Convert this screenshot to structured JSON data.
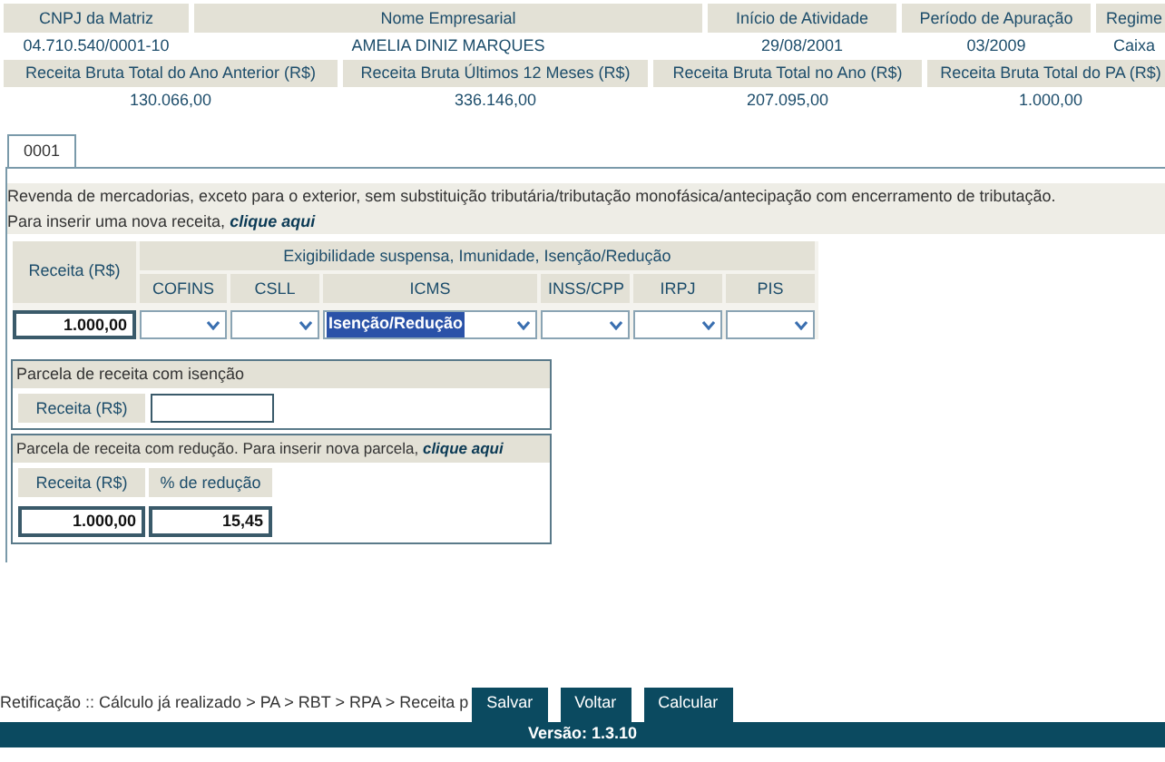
{
  "summary_row1": [
    {
      "label": "CNPJ da Matriz",
      "value": "04.710.540/0001-10"
    },
    {
      "label": "Nome Empresarial",
      "value": "AMELIA DINIZ MARQUES"
    },
    {
      "label": "Início de Atividade",
      "value": "29/08/2001"
    },
    {
      "label": "Período de Apuração",
      "value": "03/2009"
    },
    {
      "label": "Regime",
      "value": "Caixa"
    }
  ],
  "summary_row2": [
    {
      "label": "Receita Bruta Total do Ano Anterior (R$)",
      "value": "130.066,00"
    },
    {
      "label": "Receita Bruta Últimos 12 Meses (R$)",
      "value": "336.146,00"
    },
    {
      "label": "Receita Bruta Total no Ano (R$)",
      "value": "207.095,00"
    },
    {
      "label": "Receita Bruta Total do PA (R$)",
      "value": "1.000,00"
    }
  ],
  "tabs": [
    {
      "label": "0001",
      "selected": true
    }
  ],
  "description": "Revenda de mercadorias, exceto para o exterior, sem substituição tributária/tributação monofásica/antecipação com encerramento de tributação.",
  "insert_text": "Para inserir uma nova receita,",
  "insert_link": "clique aqui",
  "receita_table": {
    "receita_header": "Receita (R$)",
    "group_header": "Exigibilidade suspensa, Imunidade, Isenção/Redução",
    "receita_value": "1.000,00",
    "taxes": [
      {
        "name": "COFINS"
      },
      {
        "name": "CSLL"
      },
      {
        "name": "ICMS",
        "value": "Isenção/Redução"
      },
      {
        "name": "INSS/CPP"
      },
      {
        "name": "IRPJ"
      },
      {
        "name": "PIS"
      }
    ]
  },
  "isencao": {
    "title": "Parcela de receita com isenção",
    "label": "Receita (R$)"
  },
  "reducao": {
    "title": "Parcela de receita com redução. Para inserir nova parcela,",
    "link": "clique aqui",
    "col_receita": "Receita (R$)",
    "col_percent": "% de redução",
    "receita": "1.000,00",
    "percent": "15,45"
  },
  "breadcrumb": "Retificação :: Cálculo já realizado > PA > RBT > RPA > Receita p",
  "buttons": [
    "Salvar",
    "Voltar",
    "Calcular"
  ],
  "version": "Versão: 1.3.10"
}
